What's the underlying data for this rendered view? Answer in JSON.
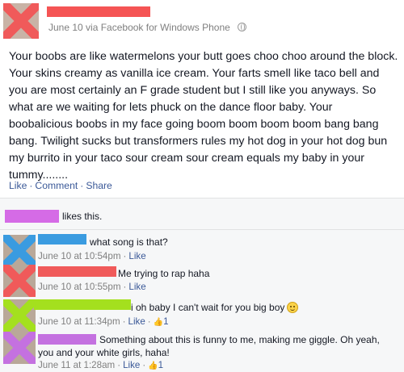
{
  "colors": {
    "post_avatar": "#f05a5a",
    "comment1_avatar": "#3a9be0",
    "comment2_avatar": "#f05a5a",
    "comment3_avatar": "#a4e01e",
    "comment4_avatar": "#c471e0"
  },
  "post": {
    "meta": "June 10 via Facebook for Windows Phone",
    "body": "Your boobs are like watermelons your butt goes choo choo around the block. Your skins creamy as vanilla ice cream. Your farts smell like taco bell and you are most certainly an F grade student but I still like you anyways. So what are we waiting for lets phuck on the dance floor baby. Your boobalicious boobs in my face going boom boom boom boom bang bang bang. Twilight sucks but transformers rules my hot dog in your hot dog bun my burrito in your taco sour cream sour cream equals my baby in your tummy........",
    "actions": {
      "like": "Like",
      "comment": "Comment",
      "share": "Share",
      "sep": "·"
    }
  },
  "likes": {
    "text": "likes this."
  },
  "comments": [
    {
      "text": "what song is that?",
      "time": "June 10 at 10:54pm",
      "like": "Like",
      "likes": ""
    },
    {
      "text": "Me trying to rap haha",
      "time": "June 10 at 10:55pm",
      "like": "Like",
      "likes": ""
    },
    {
      "text": "i oh baby I can't wait for you big boy",
      "time": "June 10 at 11:34pm",
      "like": "Like",
      "likes": "1"
    },
    {
      "text": "Something about this is funny to me, making me giggle. Oh yeah, you and your white girls, haha!",
      "time": "June 11 at 1:28am",
      "like": "Like",
      "likes": "1"
    }
  ]
}
